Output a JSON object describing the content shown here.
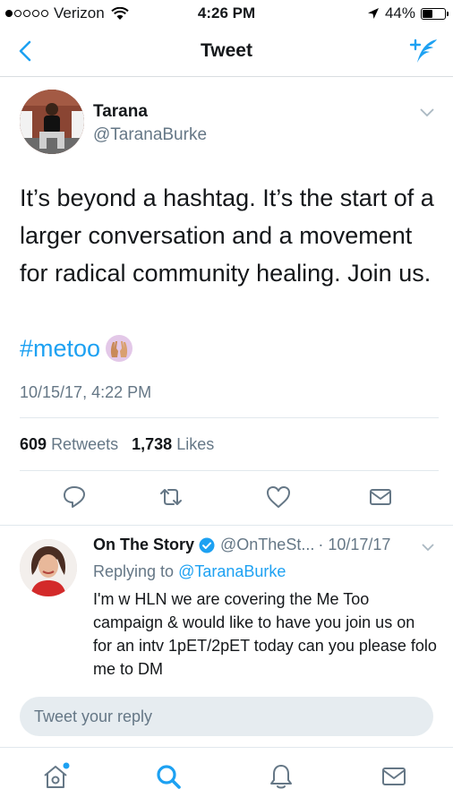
{
  "status_bar": {
    "carrier": "Verizon",
    "time": "4:26 PM",
    "battery": "44%",
    "signal_bars": 1,
    "battery_level": 0.44
  },
  "nav": {
    "title": "Tweet",
    "back_icon": "chevron-left-icon",
    "compose_icon": "compose-feather-icon"
  },
  "tweet": {
    "author_name": "Tarana",
    "author_handle": "@TaranaBurke",
    "text": "It’s beyond a hashtag. It’s the start of a larger conversation and a movement for radical community healing. Join us.",
    "hashtag": "#metoo",
    "date": "10/15/17, 4:22 PM",
    "retweets_count": "609",
    "retweets_label": "Retweets",
    "likes_count": "1,738",
    "likes_label": "Likes"
  },
  "reply": {
    "author_name": "On The Story",
    "author_handle": "@OnTheSt...",
    "date": "· 10/17/17",
    "replying_label": "Replying to",
    "replying_handle": "@TaranaBurke",
    "text": "I'm w HLN we are covering the Me Too campaign & would like to have you join us on for an intv 1pET/2pET today can you please folo me to DM"
  },
  "reply_box": {
    "placeholder": "Tweet your reply"
  },
  "colors": {
    "accent": "#1da1f2",
    "secondary_text": "#657786",
    "divider": "#e1e8ed"
  }
}
